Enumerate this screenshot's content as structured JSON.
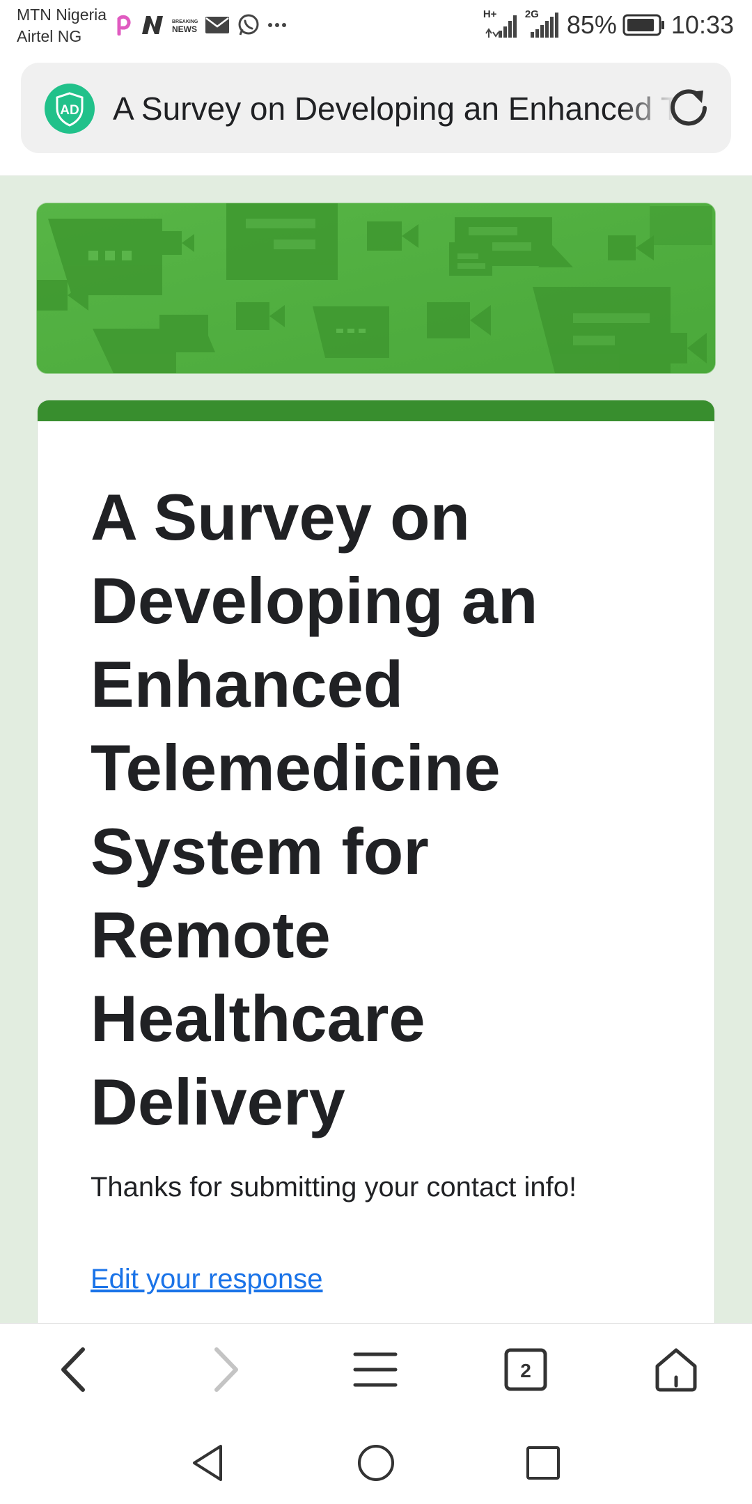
{
  "status_bar": {
    "carrier_1": "MTN Nigeria",
    "carrier_2": "Airtel NG",
    "network_1": "H+",
    "network_2": "2G",
    "battery": "85%",
    "time": "10:33",
    "notification_icons": [
      "picsart-icon",
      "n-app-icon",
      "breaking-news-icon",
      "mail-icon",
      "whatsapp-icon",
      "more-icon"
    ],
    "breaking_news_text": "BREAKING NEWS"
  },
  "browser": {
    "adblock_label": "AD",
    "url_title": "A Survey on Developing an Enhanced Telemedicine System for Remote Healthcare Delivery",
    "tab_count": "2"
  },
  "form": {
    "title": "A Survey on Developing an Enhanced Telemedicine System for Remote Healthcare Delivery",
    "confirmation_message": "Thanks for submitting your contact info!",
    "edit_link": "Edit your response"
  },
  "colors": {
    "theme_green": "#388e2e",
    "banner_green": "#4fae3f",
    "page_background": "#e2ede0",
    "link_blue": "#1a73e8",
    "adblock_green": "#21c18a"
  }
}
